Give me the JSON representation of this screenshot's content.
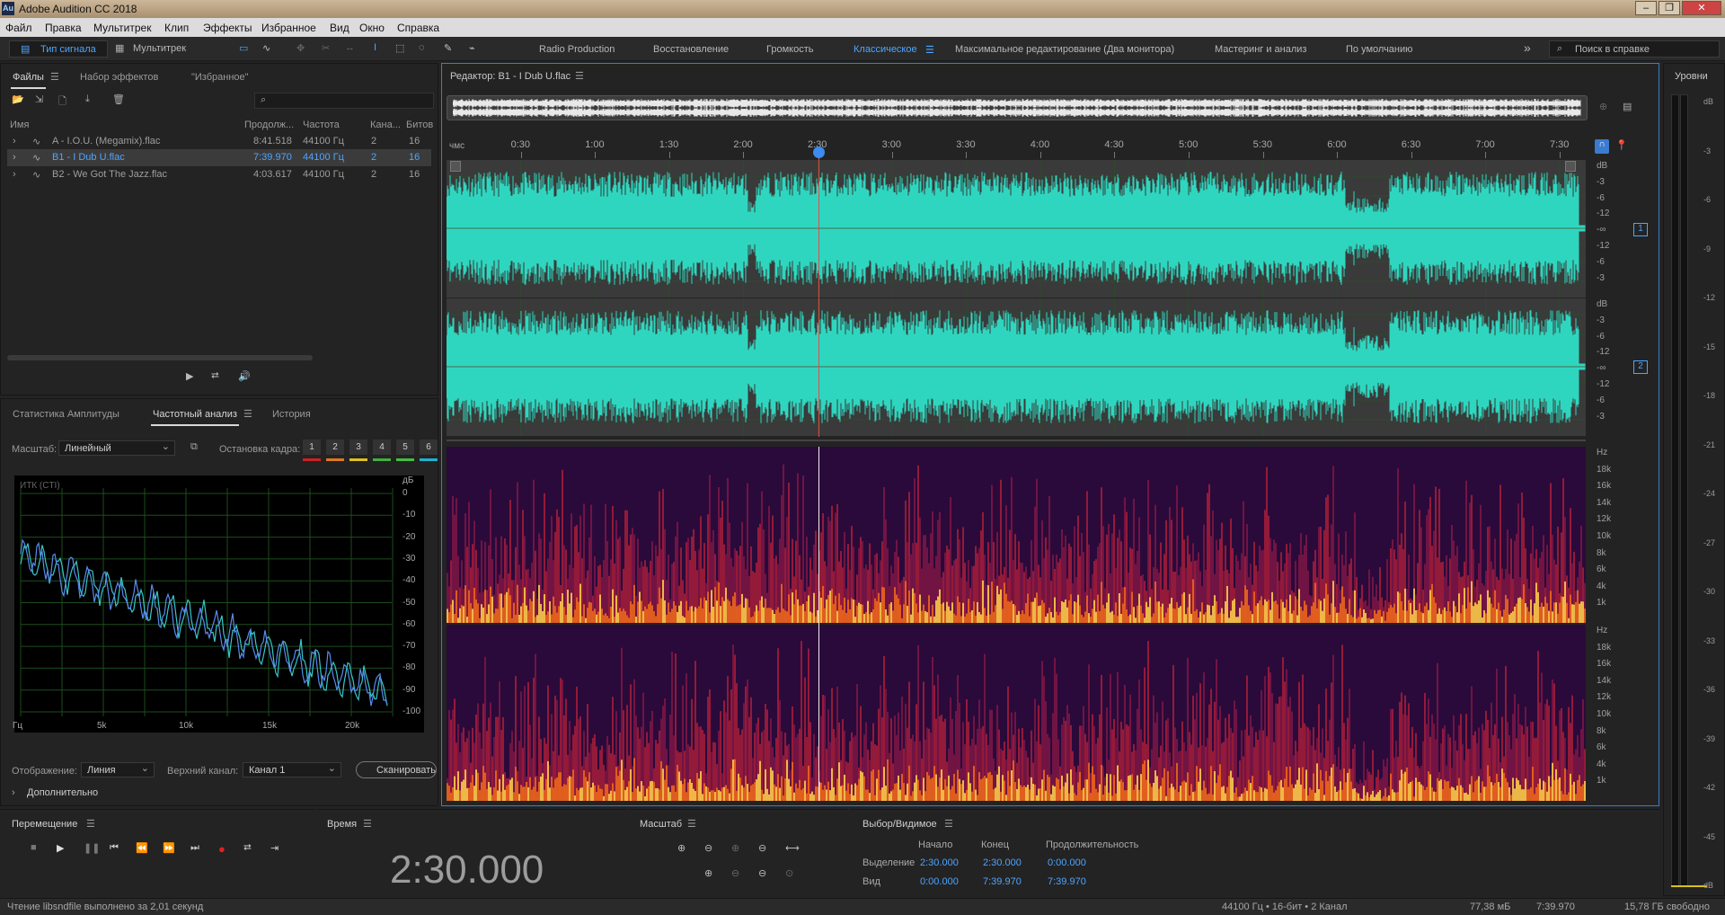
{
  "app": {
    "title": "Adobe Audition CC 2018",
    "logo": "Au"
  },
  "menu": [
    "Файл",
    "Правка",
    "Мультитрек",
    "Клип",
    "Эффекты",
    "Избранное",
    "Вид",
    "Окно",
    "Справка"
  ],
  "toolbar": {
    "waveform_label": "Тип сигнала",
    "multitrack_label": "Мультитрек",
    "workspaces": [
      "Radio Production",
      "Восстановление",
      "Громкость",
      "Классическое",
      "Максимальное редактирование (Два монитора)",
      "Мастеринг и анализ",
      "По умолчанию"
    ],
    "active_workspace": "Классическое",
    "help_placeholder": "Поиск в справке"
  },
  "files_panel": {
    "tabs": [
      "Файлы",
      "Набор эффектов",
      "\"Избранное\""
    ],
    "columns": [
      "Имя",
      "Продолж...",
      "Частота",
      "Кана...",
      "Битов"
    ],
    "rows": [
      {
        "name": "A - I.O.U. (Megamix).flac",
        "duration": "8:41.518",
        "rate": "44100 Гц",
        "channels": "2",
        "bits": "16"
      },
      {
        "name": "B1 - I Dub U.flac",
        "duration": "7:39.970",
        "rate": "44100 Гц",
        "channels": "2",
        "bits": "16"
      },
      {
        "name": "B2 - We Got The Jazz.flac",
        "duration": "4:03.617",
        "rate": "44100 Гц",
        "channels": "2",
        "bits": "16"
      }
    ]
  },
  "analysis_panel": {
    "tabs": [
      "Статистика Амплитуды",
      "Частотный анализ",
      "История"
    ],
    "scale_label": "Масштаб:",
    "scale_value": "Линейный",
    "freeze_label": "Остановка кадра:",
    "freeze_frames": [
      "1",
      "2",
      "3",
      "4",
      "5",
      "6"
    ],
    "freeze_colors": [
      "#d02020",
      "#e07820",
      "#e0c020",
      "#40b040",
      "#40c040",
      "#20b0d0"
    ],
    "chart_caption": "ИТК (CTI)",
    "db_unit": "дБ",
    "db_ticks": [
      "0",
      "-10",
      "-20",
      "-30",
      "-40",
      "-50",
      "-60",
      "-70",
      "-80",
      "-90",
      "-100"
    ],
    "freq_ticks": [
      "Гц",
      "5k",
      "10k",
      "15k",
      "20k"
    ],
    "display_label": "Отображение:",
    "display_value": "Линия",
    "top_channel_label": "Верхний канал:",
    "top_channel_value": "Канал 1",
    "scan_button": "Сканировать",
    "more_label": "Дополнительно"
  },
  "editor": {
    "title": "Редактор: B1 - I Dub U.flac",
    "ruler_unit": "чмс",
    "ruler_ticks": [
      "0:30",
      "1:00",
      "1:30",
      "2:00",
      "2:30",
      "3:00",
      "3:30",
      "4:00",
      "4:30",
      "5:00",
      "5:30",
      "6:00",
      "6:30",
      "7:00",
      "7:30"
    ],
    "db_ticks": [
      "dB",
      "-3",
      "-6",
      "-12",
      "-∞",
      "-12",
      "-6",
      "-3"
    ],
    "hz_ticks": [
      "Hz",
      "18k",
      "16k",
      "14k",
      "12k",
      "10k",
      "8k",
      "6k",
      "4k",
      "1k"
    ],
    "channel_badges": [
      "1",
      "2"
    ],
    "waveform_color": "#2fd6bf"
  },
  "levels_panel": {
    "title": "Уровни",
    "ticks": [
      "dB",
      "-3",
      "-6",
      "-9",
      "-12",
      "-15",
      "-18",
      "-21",
      "-24",
      "-27",
      "-30",
      "-33",
      "-36",
      "-39",
      "-42",
      "-45",
      "dB"
    ]
  },
  "transport": {
    "title": "Перемещение"
  },
  "time_panel": {
    "title": "Время",
    "value": "2:30.000"
  },
  "zoom_panel": {
    "title": "Масштаб"
  },
  "selection_panel": {
    "title": "Выбор/Видимое",
    "headers": [
      "Начало",
      "Конец",
      "Продолжительность"
    ],
    "rows": [
      {
        "label": "Выделение",
        "start": "2:30.000",
        "end": "2:30.000",
        "duration": "0:00.000"
      },
      {
        "label": "Вид",
        "start": "0:00.000",
        "end": "7:39.970",
        "duration": "7:39.970"
      }
    ]
  },
  "status": {
    "message": "Чтение libsndfile выполнено за 2,01 секунд",
    "format": "44100 Гц • 16-бит • 2 Канал",
    "size": "77,38 мБ",
    "duration": "7:39.970",
    "free": "15,78 ГБ свободно"
  }
}
